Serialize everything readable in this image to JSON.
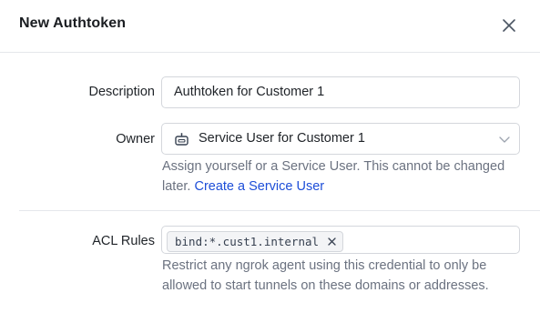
{
  "dialog": {
    "title": "New Authtoken",
    "close_icon": "close-icon"
  },
  "form": {
    "description": {
      "label": "Description",
      "value": "Authtoken for Customer 1"
    },
    "owner": {
      "label": "Owner",
      "icon": "robot-icon",
      "value": "Service User for Customer 1",
      "help_text": "Assign yourself or a Service User. This cannot be changed later. ",
      "help_link": "Create a Service User"
    },
    "acl_rules": {
      "label": "ACL Rules",
      "chips": [
        "bind:*.cust1.internal"
      ],
      "help_text": "Restrict any ngrok agent using this credential to only be allowed to start tunnels on these domains or addresses."
    }
  },
  "colors": {
    "link": "#1d4ed8",
    "muted_text": "#6b7280",
    "border": "#d4d7dc"
  }
}
